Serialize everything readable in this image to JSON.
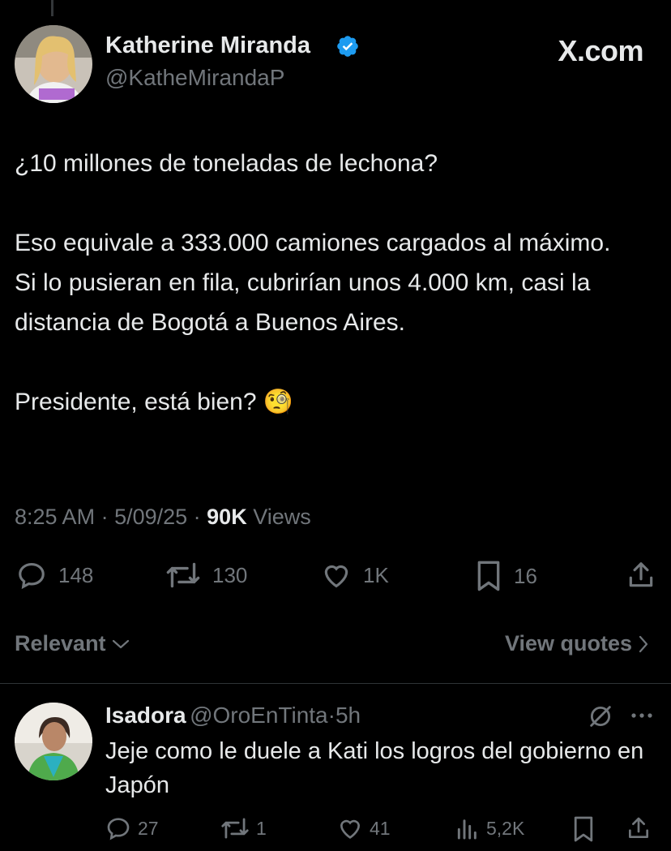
{
  "post": {
    "author_name": "Katherine Miranda",
    "author_handle": "@KatheMirandaP",
    "source_logo": "X.com",
    "lines": [
      "¿10 millones de toneladas de lechona?",
      "Eso equivale a 333.000 camiones cargados al máximo.",
      "Si lo pusieran en fila, cubrirían unos 4.000 km, casi la distancia de Bogotá a Buenos Aires.",
      "Presidente, está bien?"
    ],
    "emoji": "🧐",
    "time": "8:25 AM",
    "date": "5/09/25",
    "views_count": "90K",
    "views_label": "Views",
    "actions": {
      "replies": "148",
      "reposts": "130",
      "likes": "1K",
      "bookmarks": "16"
    }
  },
  "filters": {
    "sort_label": "Relevant",
    "view_quotes_label": "View quotes"
  },
  "reply": {
    "author_name": "Isadora",
    "author_handle": "@OroEnTinta",
    "time": "5h",
    "text": "Jeje como le duele a Kati los logros del gobierno en Japón",
    "actions": {
      "replies": "27",
      "reposts": "1",
      "likes": "41",
      "views": "5,2K"
    }
  },
  "colors": {
    "background": "#000000",
    "text": "#e7e9ea",
    "muted": "#71767b",
    "verified": "#1d9bf0",
    "divider": "#2f3336"
  }
}
